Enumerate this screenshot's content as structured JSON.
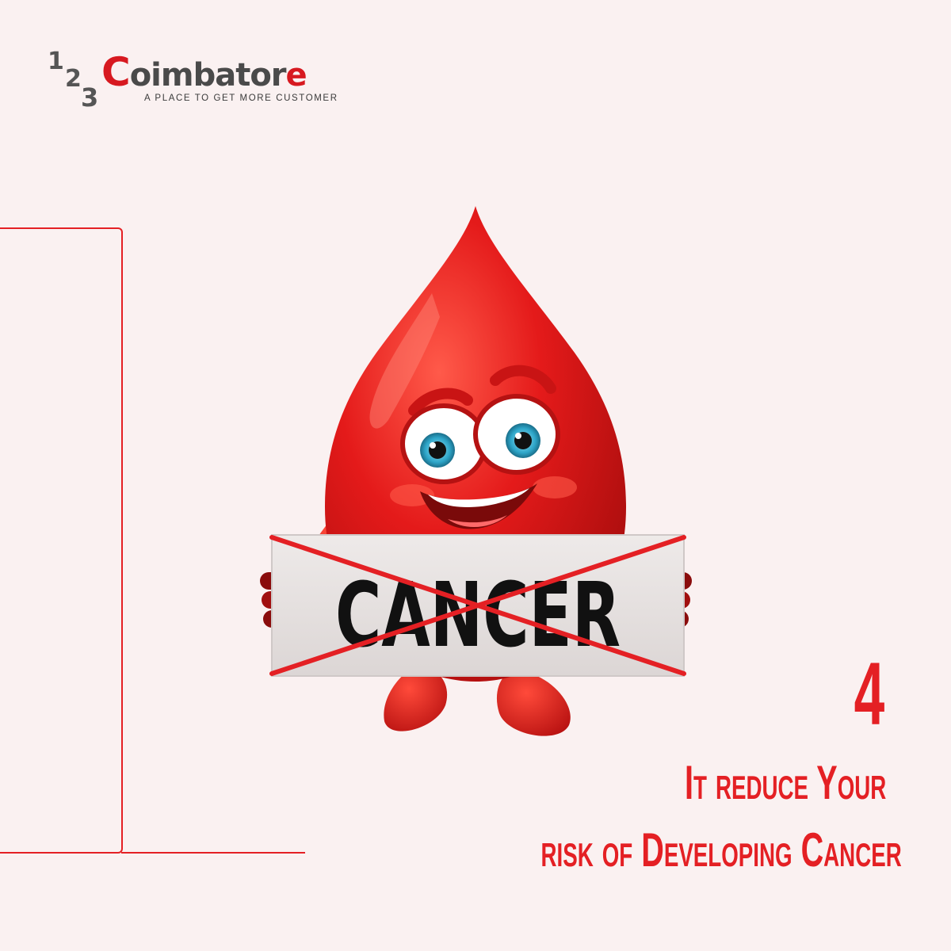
{
  "brand": {
    "digits": [
      "1",
      "2",
      "3"
    ],
    "name_first_letter": "C",
    "name_rest": "oimbator",
    "name_last_letter": "e",
    "tagline": "A PLACE TO GET MORE CUSTOMER",
    "accent_color": "#d71920"
  },
  "sign": {
    "text": "CANCER"
  },
  "fact": {
    "number": "4",
    "line1": "It reduce Your",
    "line2": "risk of Developing Cancer"
  },
  "colors": {
    "background": "#faf1f1",
    "accent": "#e42024",
    "drop": "#e01b1b"
  },
  "icons": {
    "mascot": "blood-drop-mascot",
    "strike": "red-x-cross"
  }
}
